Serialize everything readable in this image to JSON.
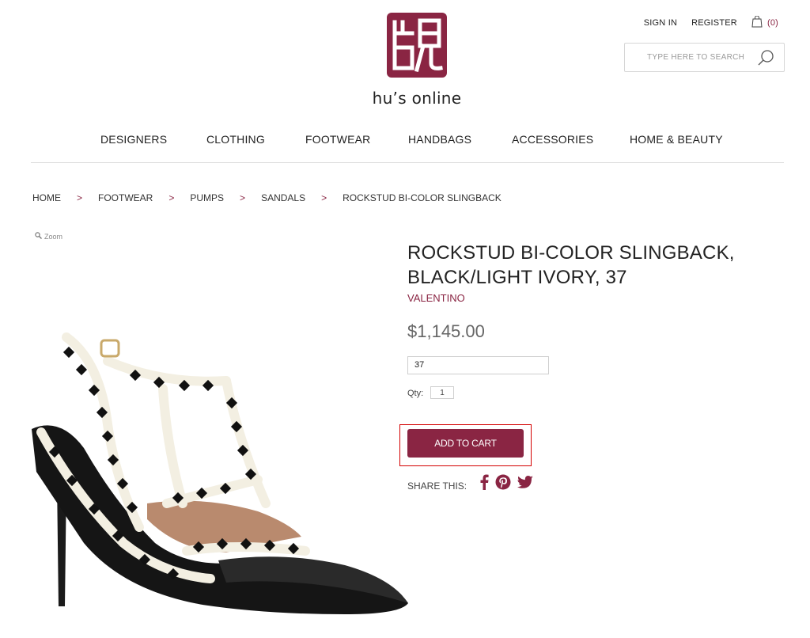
{
  "header": {
    "sign_in": "SIGN IN",
    "register": "REGISTER",
    "cart_count": "(0)",
    "search_placeholder": "TYPE HERE TO SEARCH",
    "logo_text": "hu’s online"
  },
  "nav": {
    "items": [
      "DESIGNERS",
      "CLOTHING",
      "FOOTWEAR",
      "HANDBAGS",
      "ACCESSORIES",
      "HOME & BEAUTY"
    ]
  },
  "breadcrumb": {
    "items": [
      "HOME",
      "FOOTWEAR",
      "PUMPS",
      "SANDALS",
      "ROCKSTUD BI-COLOR SLINGBACK"
    ],
    "separator": ">"
  },
  "product": {
    "zoom_label": "Zoom",
    "title": "ROCKSTUD BI-COLOR SLINGBACK, BLACK/LIGHT IVORY, 37",
    "brand": "VALENTINO",
    "price": "$1,145.00",
    "size_value": "37",
    "qty_label": "Qty:",
    "qty_value": "1",
    "add_to_cart": "ADD TO CART",
    "share_label": "SHARE THIS:",
    "share_icons": [
      "facebook-icon",
      "pinterest-icon",
      "twitter-icon"
    ]
  },
  "colors": {
    "brand": "#8a2543",
    "highlight": "#d40000"
  }
}
